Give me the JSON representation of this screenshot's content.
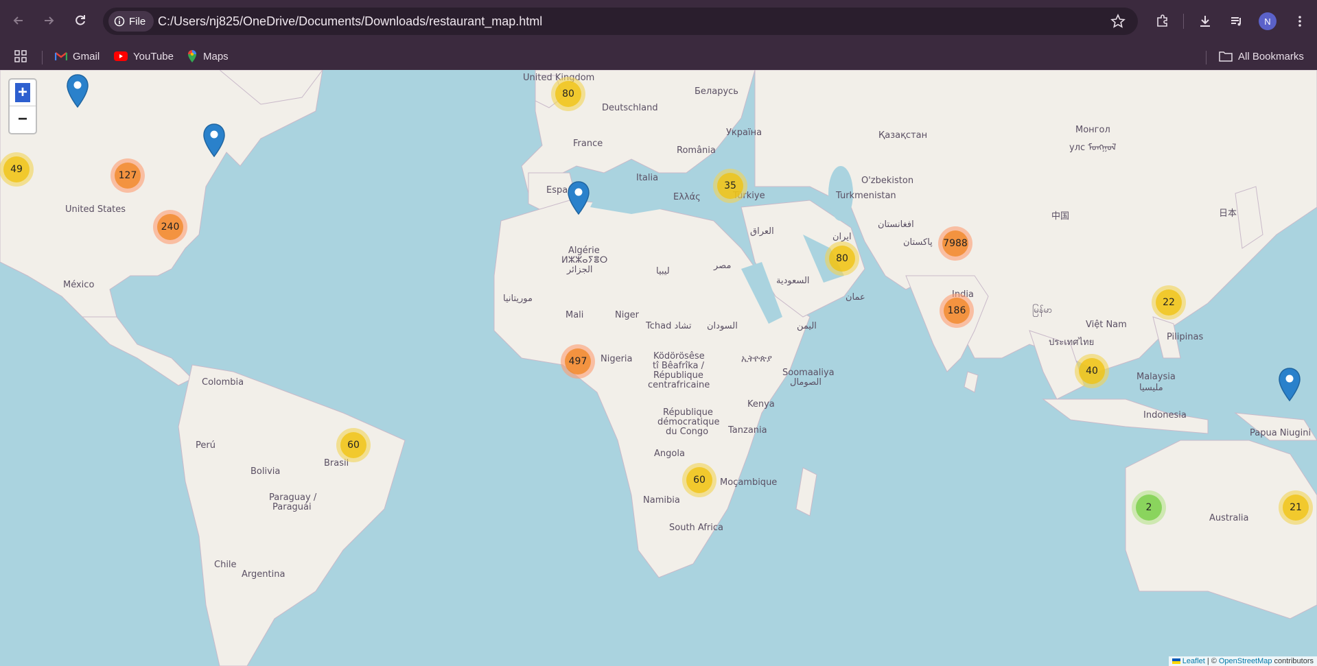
{
  "browser": {
    "site_chip_label": "File",
    "url": "C:/Users/nj825/OneDrive/Documents/Downloads/restaurant_map.html",
    "avatar_initial": "N"
  },
  "bookmarks": {
    "items": [
      {
        "label": "Gmail",
        "icon": "gmail-icon"
      },
      {
        "label": "YouTube",
        "icon": "youtube-icon"
      },
      {
        "label": "Maps",
        "icon": "maps-icon"
      }
    ],
    "all_bookmarks_label": "All Bookmarks"
  },
  "map": {
    "zoom_in_label": "+",
    "zoom_out_label": "−",
    "clusters": [
      {
        "count": "80",
        "level": "yellow"
      },
      {
        "count": "49",
        "level": "yellow"
      },
      {
        "count": "127",
        "level": "orange"
      },
      {
        "count": "240",
        "level": "orange"
      },
      {
        "count": "35",
        "level": "yellow"
      },
      {
        "count": "80",
        "level": "yellow"
      },
      {
        "count": "7988",
        "level": "orange"
      },
      {
        "count": "186",
        "level": "orange"
      },
      {
        "count": "22",
        "level": "yellow"
      },
      {
        "count": "497",
        "level": "orange"
      },
      {
        "count": "40",
        "level": "yellow"
      },
      {
        "count": "60",
        "level": "yellow"
      },
      {
        "count": "60",
        "level": "yellow"
      },
      {
        "count": "2",
        "level": "green"
      },
      {
        "count": "21",
        "level": "yellow"
      }
    ],
    "labels": [
      "United Kingdom",
      "Беларусь",
      "Deutschland",
      "Україна",
      "France",
      "România",
      "Қазақстан",
      "Монгол",
      "улс ᠮᠣᠩᠭᠣᠯ",
      "España",
      "Italia",
      "Ελλάς",
      "Türkiye",
      "O'zbekiston",
      "Turkmenistan",
      "United States",
      "العراق",
      "ایران",
      "افغانستان",
      "پاکستان",
      "中国",
      "日本",
      "México",
      "Algérie",
      "ⵍⵣⵣⴰⵢⴻⵔ",
      "الجزائر",
      "ليبيا",
      "مصر",
      "السعودية",
      "عمان",
      "India",
      "موريتانيا",
      "Mali",
      "Niger",
      "Tchad تشاد",
      "السودان",
      "اليمن",
      "မြန်မာ",
      "Việt Nam",
      "ประเทศไทย",
      "Pilipinas",
      "Nigeria",
      "Ködörösêse",
      "tî Bêafrîka /",
      "République",
      "centrafricaine",
      "ኢትዮጵያ",
      "Soomaaliya",
      "الصومال",
      "Colombia",
      "Malaysia",
      "مليسيا",
      "Kenya",
      "République",
      "démocratique",
      "du Congo",
      "Indonesia",
      "Papua Niugini",
      "Tanzania",
      "Perú",
      "Brasil",
      "Bolivia",
      "Angola",
      "Moçambique",
      "Paraguay /",
      "Paraguái",
      "Namibia",
      "Australia",
      "South Africa",
      "Chile",
      "Argentina"
    ],
    "attribution": {
      "leaflet_label": "Leaflet",
      "separator": "| ©",
      "osm_label": "OpenStreetMap",
      "suffix": "contributors"
    }
  }
}
